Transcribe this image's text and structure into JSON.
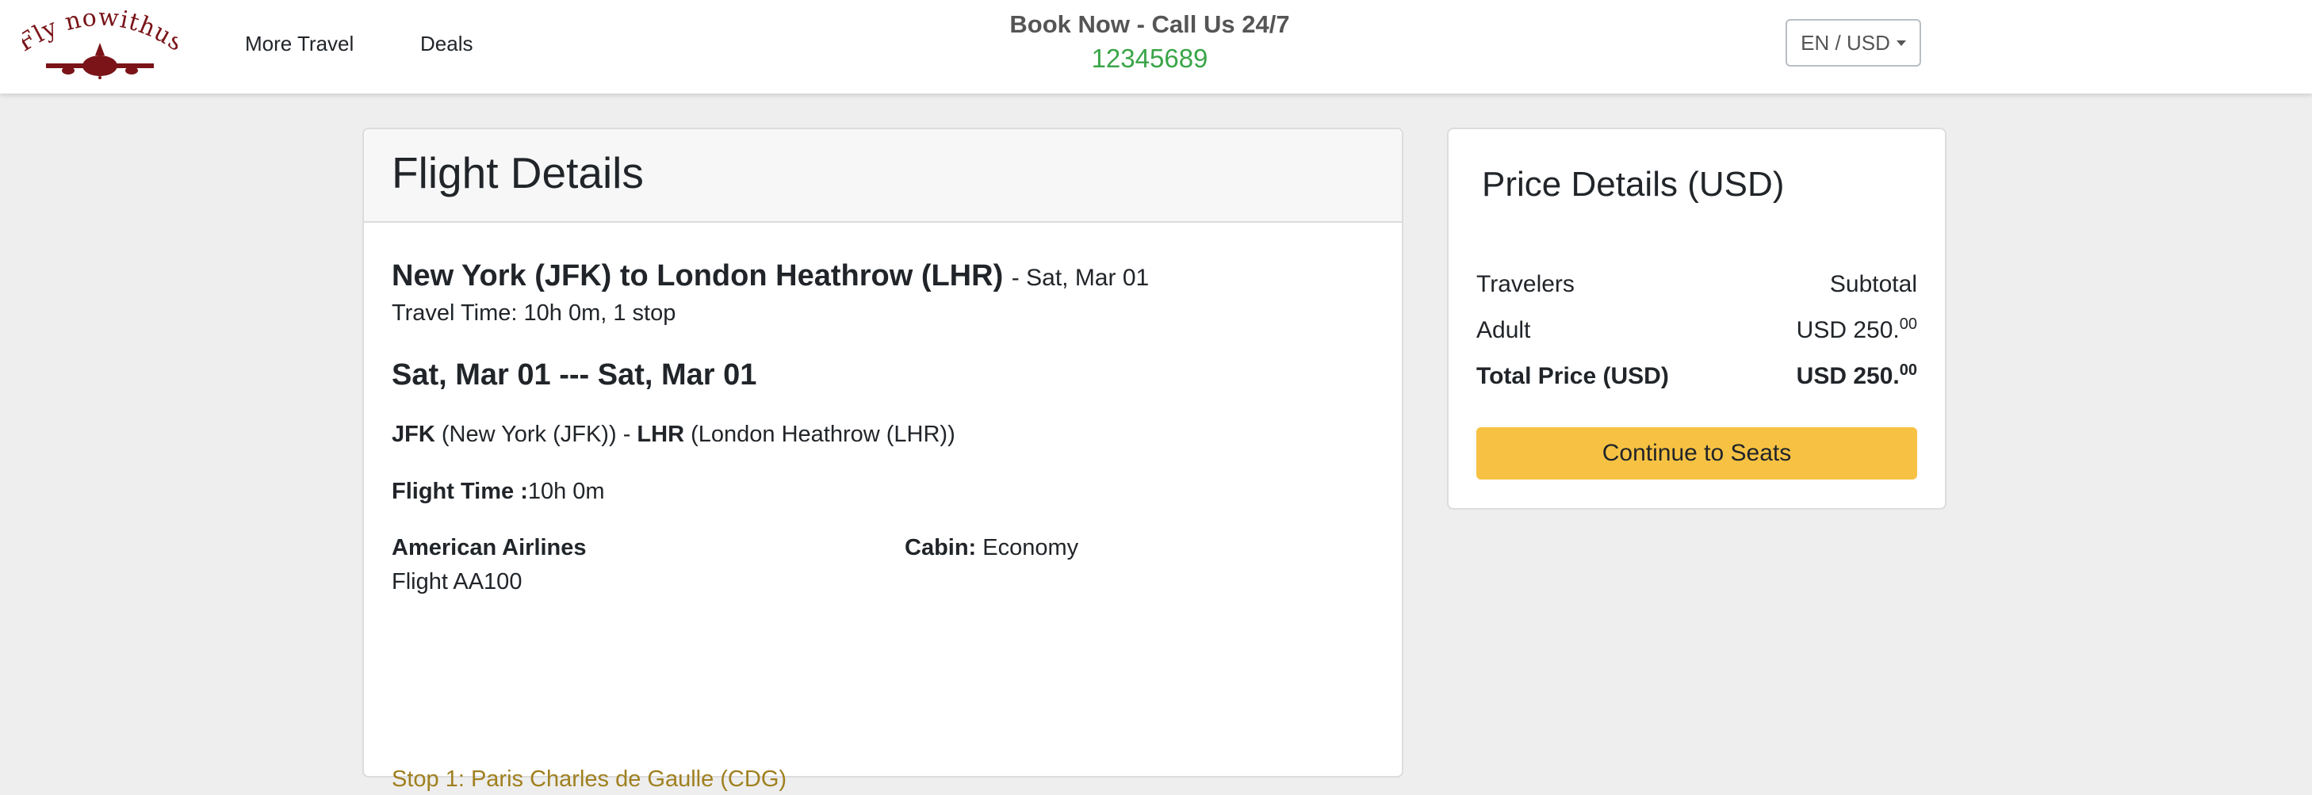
{
  "brand": {
    "name": "Fly nowithus",
    "color": "#7a1418"
  },
  "nav": {
    "more_travel": "More Travel",
    "deals": "Deals"
  },
  "callout": {
    "title": "Book Now - Call Us 24/7",
    "phone": "12345689"
  },
  "locale_button": "EN / USD",
  "flight": {
    "title": "Flight Details",
    "route": "New York (JFK) to London Heathrow (LHR)",
    "route_date": "- Sat, Mar 01",
    "travel_time": "Travel Time: 10h 0m, 1 stop",
    "date_range": "Sat, Mar 01 --- Sat, Mar 01",
    "origin_code": "JFK",
    "origin_name": "(New York (JFK))",
    "separator": "-",
    "dest_code": "LHR",
    "dest_name": "(London Heathrow (LHR))",
    "flight_time_label": "Flight Time :",
    "flight_time_value": "10h 0m",
    "airline": "American Airlines",
    "flight_number": "Flight AA100",
    "cabin_label": "Cabin:",
    "cabin_value": "Economy",
    "stop": "Stop 1: Paris Charles de Gaulle (CDG)"
  },
  "price": {
    "title": "Price Details (USD)",
    "col_travelers": "Travelers",
    "col_subtotal": "Subtotal",
    "adult_label": "Adult",
    "adult_amount": "USD 250.",
    "adult_cents": "00",
    "total_label": "Total Price (USD)",
    "total_amount": "USD 250.",
    "total_cents": "00",
    "continue": "Continue to Seats",
    "button_color": "#f7c243"
  }
}
